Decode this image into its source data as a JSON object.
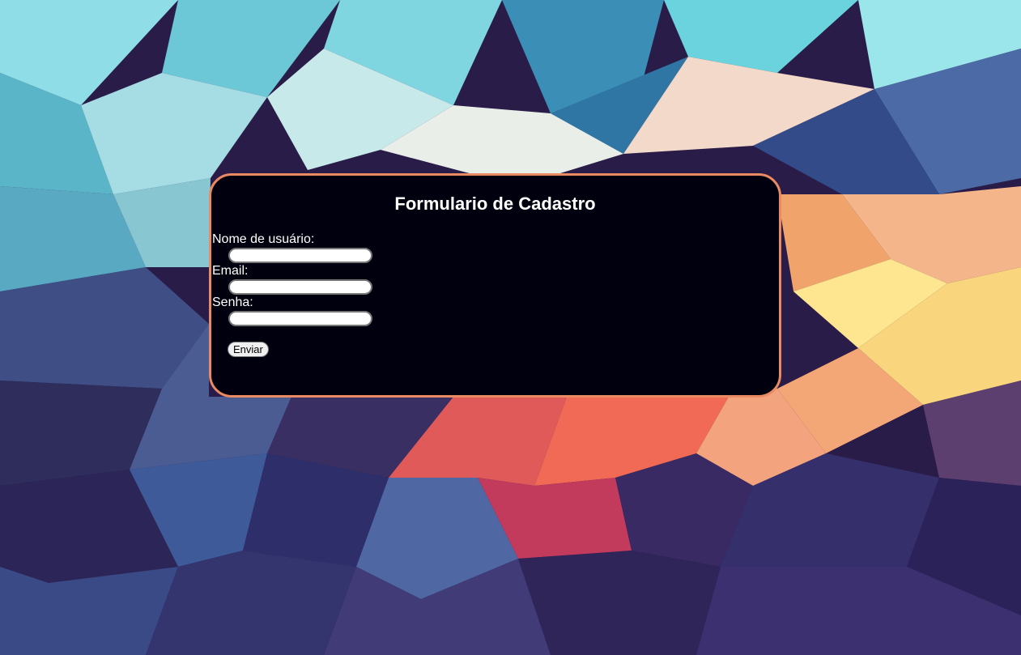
{
  "form": {
    "title": "Formulario de Cadastro",
    "username_label": "Nome de usuário:",
    "username_value": "",
    "email_label": "Email:",
    "email_value": "",
    "password_label": "Senha:",
    "password_value": "",
    "submit_label": "Enviar"
  },
  "colors": {
    "card_background": "#00000f",
    "card_border": "#ea8a63",
    "text": "#ffffff"
  }
}
